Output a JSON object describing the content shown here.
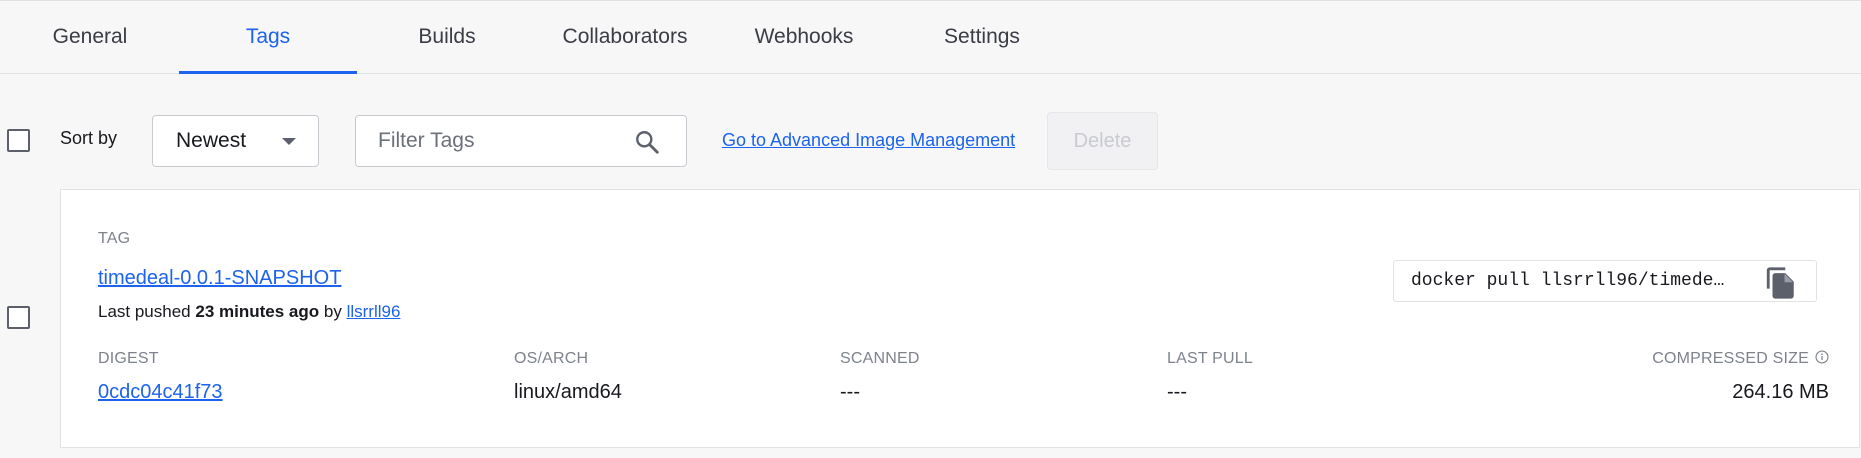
{
  "tabs": [
    {
      "label": "General"
    },
    {
      "label": "Tags"
    },
    {
      "label": "Builds"
    },
    {
      "label": "Collaborators"
    },
    {
      "label": "Webhooks"
    },
    {
      "label": "Settings"
    }
  ],
  "active_tab": "Tags",
  "toolbar": {
    "sort_label": "Sort by",
    "sort_value": "Newest",
    "filter_placeholder": "Filter Tags",
    "advanced_link": "Go to Advanced Image Management",
    "delete_label": "Delete"
  },
  "tag_card": {
    "section_label": "TAG",
    "tag_name": "timedeal-0.0.1-SNAPSHOT",
    "pushed_prefix": "Last pushed",
    "pushed_time": "23 minutes ago",
    "pushed_by_word": "by",
    "pushed_user": "llsrrll96",
    "pull_command": "docker pull llsrrll96/timedeal-0.0.1-SNAPSHOT",
    "columns": {
      "digest_label": "DIGEST",
      "os_arch_label": "OS/ARCH",
      "scanned_label": "SCANNED",
      "last_pull_label": "LAST PULL",
      "size_label": "COMPRESSED SIZE"
    },
    "values": {
      "digest": "0cdc04c41f73",
      "os_arch": "linux/amd64",
      "scanned": "---",
      "last_pull": "---",
      "size": "264.16 MB"
    }
  },
  "colors": {
    "accent": "#1d63ed",
    "text": "#17191e",
    "muted": "#7d828d",
    "border": "#e1e2e6"
  }
}
